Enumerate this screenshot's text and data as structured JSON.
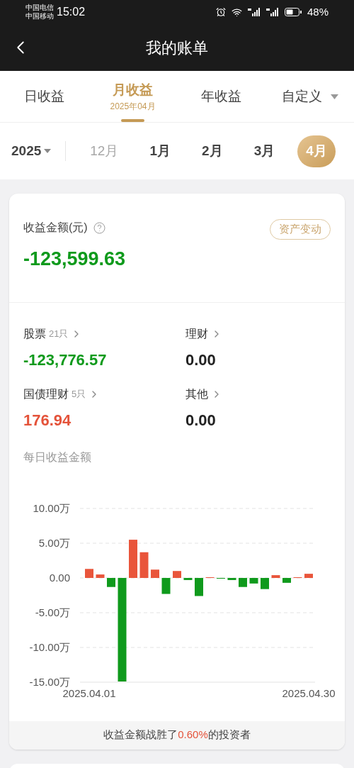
{
  "status_bar": {
    "carriers": [
      "中国电信",
      "中国移动"
    ],
    "time": "15:02",
    "battery": "48%"
  },
  "header": {
    "title": "我的账单"
  },
  "tabs": [
    {
      "label": "日收益",
      "selected": false
    },
    {
      "label": "月收益",
      "subtitle": "2025年04月",
      "selected": true
    },
    {
      "label": "年收益",
      "selected": false
    },
    {
      "label": "自定义",
      "selected": false,
      "kind": "dropdown"
    }
  ],
  "year": "2025",
  "months": [
    {
      "label": "12月",
      "selected": false,
      "disabled": true
    },
    {
      "label": "1月",
      "selected": false,
      "disabled": false
    },
    {
      "label": "2月",
      "selected": false,
      "disabled": false
    },
    {
      "label": "3月",
      "selected": false,
      "disabled": false
    },
    {
      "label": "4月",
      "selected": true,
      "disabled": false
    }
  ],
  "summary": {
    "label": "收益金额(元)",
    "amount": "-123,599.63",
    "color": "#0f9a1c",
    "action": "资产变动"
  },
  "categories": [
    {
      "name": "股票",
      "count": "21只",
      "amount": "-123,776.57",
      "color": "#0f9a1c"
    },
    {
      "name": "理财",
      "amount": "0.00",
      "color": "#222222"
    },
    {
      "name": "国债理财",
      "count": "5只",
      "amount": "176.94",
      "color": "#e4533a"
    },
    {
      "name": "其他",
      "amount": "0.00",
      "color": "#222222"
    }
  ],
  "daily": {
    "title": "每日收益金额",
    "chart_data": {
      "type": "bar",
      "categories": [
        "2025.04.01",
        null,
        null,
        null,
        null,
        null,
        null,
        null,
        null,
        null,
        null,
        null,
        null,
        null,
        null,
        null,
        null,
        null,
        null,
        null,
        "2025.04.30"
      ],
      "series": [
        {
          "color": "#e9553b",
          "values": [
            1.3,
            0.5,
            null,
            null,
            5.5,
            3.7,
            1.2,
            null,
            1.0,
            null,
            null,
            0.1,
            null,
            null,
            null,
            null,
            null,
            0.4,
            null,
            0.1,
            0.6
          ]
        },
        {
          "color": "#0f9a1c",
          "values": [
            null,
            null,
            -1.3,
            -14.9,
            null,
            null,
            null,
            -2.3,
            null,
            -0.3,
            -2.6,
            null,
            -0.1,
            -0.3,
            -1.3,
            -0.8,
            -1.6,
            null,
            -0.7,
            null,
            null
          ]
        }
      ],
      "stacked": true,
      "grid": true,
      "ylim": [
        -15,
        10
      ],
      "yticks": [
        {
          "value": 10,
          "label": "10.00万"
        },
        {
          "value": 5,
          "label": "5.00万"
        },
        {
          "value": 0,
          "label": "0.00"
        },
        {
          "value": -5,
          "label": "-5.00万"
        },
        {
          "value": -10,
          "label": "-10.00万"
        },
        {
          "value": -15,
          "label": "-15.00万"
        }
      ]
    }
  },
  "beat": {
    "before": "收益金额战胜了",
    "highlight": "0.60%",
    "after": "的投资者"
  }
}
